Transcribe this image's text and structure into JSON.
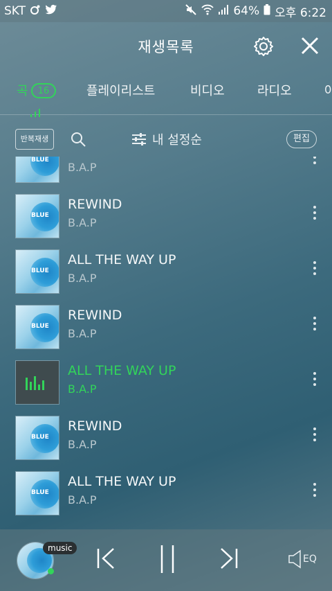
{
  "status_bar": {
    "carrier": "SKT",
    "battery": "64%",
    "time": "오후 6:22"
  },
  "header": {
    "title": "재생목록"
  },
  "tabs": [
    {
      "label": "곡",
      "badge": "16",
      "active": true
    },
    {
      "label": "플레이리스트"
    },
    {
      "label": "비디오"
    },
    {
      "label": "라디오"
    },
    {
      "label": "아"
    }
  ],
  "controls": {
    "repeat_label": "반복재생",
    "sort_label": "내 설정순",
    "edit_label": "편집"
  },
  "songs": [
    {
      "title": "",
      "artist": "B.A.P",
      "art": "blue"
    },
    {
      "title": "REWIND",
      "artist": "B.A.P",
      "art": "blue"
    },
    {
      "title": "ALL THE WAY UP",
      "artist": "B.A.P",
      "art": "blue"
    },
    {
      "title": "REWIND",
      "artist": "B.A.P",
      "art": "blue"
    },
    {
      "title": "ALL THE WAY UP",
      "artist": "B.A.P",
      "art": "playing",
      "playing": true
    },
    {
      "title": "REWIND",
      "artist": "B.A.P",
      "art": "blue"
    },
    {
      "title": "ALL THE WAY UP",
      "artist": "B.A.P",
      "art": "blue"
    }
  ],
  "album_art_text": "BLUE",
  "player": {
    "badge": "music",
    "eq_label": "EQ"
  },
  "colors": {
    "accent": "#32d45a"
  }
}
